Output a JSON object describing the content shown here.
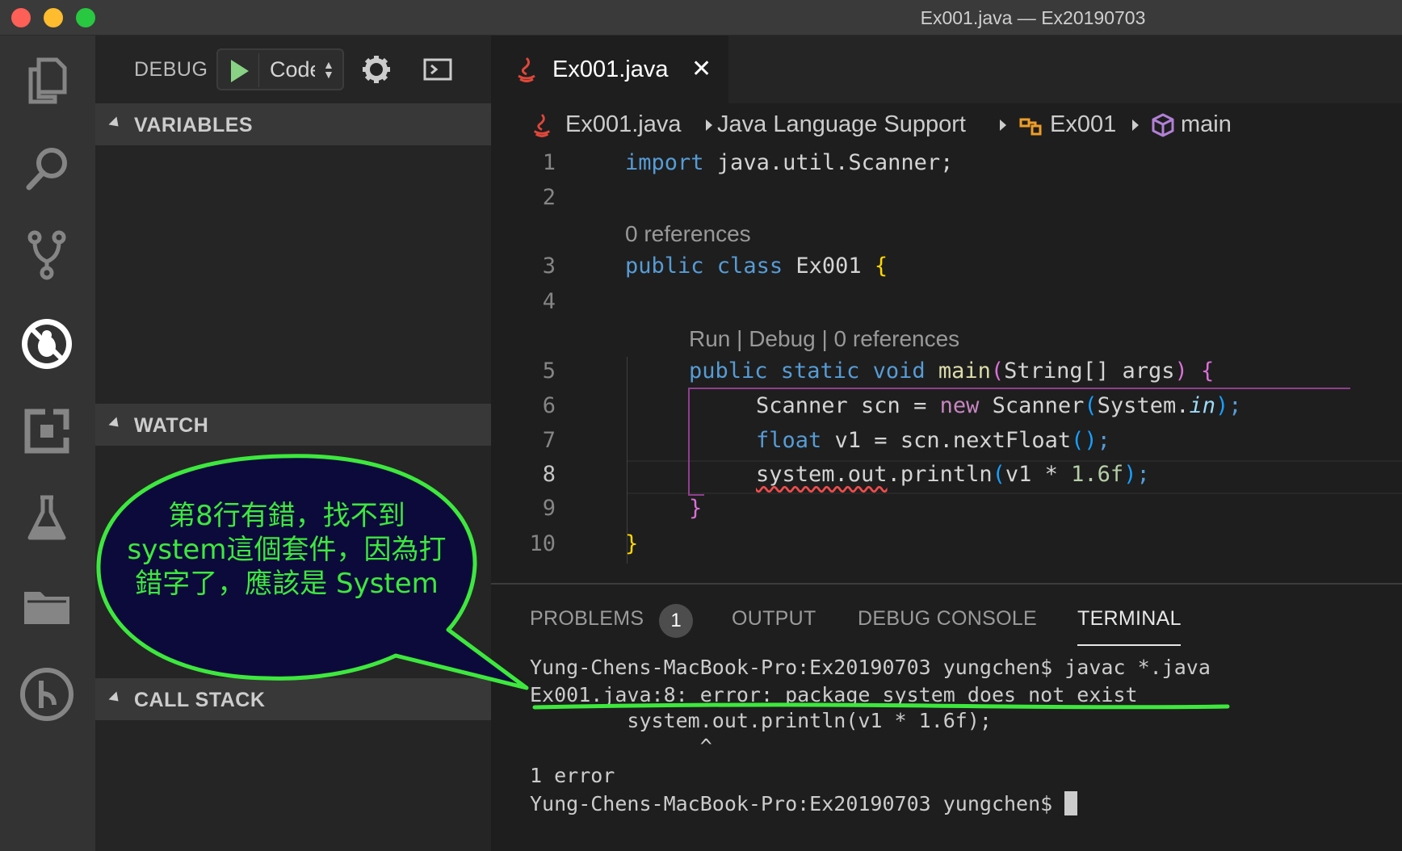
{
  "window": {
    "title": "Ex001.java — Ex20190703"
  },
  "activity_bar": {
    "icons": [
      "explorer-icon",
      "search-icon",
      "source-control-icon",
      "debug-icon",
      "extensions-icon",
      "test-icon",
      "folder-icon",
      "git-graph-icon"
    ]
  },
  "sidebar": {
    "debug_label": "DEBUG",
    "launch_config": "Code",
    "sections": {
      "variables": "VARIABLES",
      "watch": "WATCH",
      "call_stack": "CALL STACK"
    }
  },
  "editor": {
    "tab_label": "Ex001.java",
    "tab_close": "✕",
    "breadcrumb": {
      "file": "Ex001.java",
      "support": "Java Language Support",
      "class": "Ex001",
      "method": "main"
    },
    "line_numbers": [
      "1",
      "2",
      "3",
      "4",
      "5",
      "6",
      "7",
      "8",
      "9",
      "10"
    ],
    "code_lens": {
      "class_refs": "0 references",
      "main_lens": "Run | Debug | 0 references"
    },
    "code_lines": {
      "l1_import": "import",
      "l1_rest": " java.util.Scanner;",
      "l3_public": "public",
      "l3_class": " class",
      "l3_name": " Ex001 ",
      "l3_brace": "{",
      "l5_mods": "public static void",
      "l5_main": " main",
      "l5_open": "(",
      "l5_args": "String[] args",
      "l5_close": ")",
      "l5_brace": " {",
      "l6_a": "Scanner scn = ",
      "l6_new": "new",
      "l6_b": " Scanner",
      "l6_open": "(",
      "l6_c": "System.",
      "l6_in": "in",
      "l6_close": ")",
      "l6_semi": ";",
      "l7_float": "float",
      "l7_a": " v1 = scn.nextFloat",
      "l7_paren": "()",
      "l7_semi": ";",
      "l8_err": "system.out",
      "l8_a": ".println",
      "l8_open": "(",
      "l8_b": "v1 * ",
      "l8_num": "1.6f",
      "l8_close": ")",
      "l8_semi": ";",
      "l9_brace": "}",
      "l10_brace": "}"
    }
  },
  "panel": {
    "tabs": {
      "problems": "PROBLEMS",
      "problems_count": "1",
      "output": "OUTPUT",
      "debug_console": "DEBUG CONSOLE",
      "terminal": "TERMINAL"
    },
    "terminal_lines": [
      "Yung-Chens-MacBook-Pro:Ex20190703 yungchen$ javac *.java",
      "Ex001.java:8: error: package system does not exist",
      "        system.out.println(v1 * 1.6f);",
      "              ^",
      "1 error",
      "Yung-Chens-MacBook-Pro:Ex20190703 yungchen$ "
    ]
  },
  "annotation": {
    "line1": "第8行有錯，找不到",
    "line2": "system這個套件，因為打",
    "line3": "錯字了，應該是 System",
    "colors": {
      "fill": "#0c0a3a",
      "stroke": "#3de83d"
    }
  },
  "colors": {
    "keyword": "#569cd6",
    "control": "#c586c0",
    "function": "#dcdcaa",
    "number": "#b5cea8",
    "error_squiggle": "#f14c4c",
    "play_green": "#89d185"
  }
}
